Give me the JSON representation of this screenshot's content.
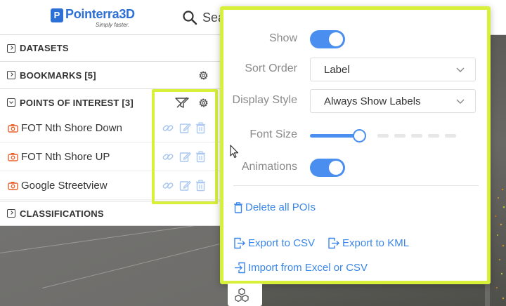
{
  "header": {
    "logo_text": "Pointerra3D",
    "logo_tagline": "Simply faster.",
    "search_text": "Sea"
  },
  "sidebar": {
    "sections": [
      {
        "label": "DATASETS",
        "expanded": false
      },
      {
        "label": "BOOKMARKS [5]",
        "expanded": false
      },
      {
        "label": "POINTS OF INTEREST [3]",
        "expanded": true
      },
      {
        "label": "CLASSIFICATIONS",
        "expanded": false
      }
    ],
    "poi_items": [
      {
        "label": "FOT Nth Shore Down"
      },
      {
        "label": "FOT Nth Shore UP"
      },
      {
        "label": "Google Streetview"
      }
    ]
  },
  "poi_settings": {
    "show_label": "Show",
    "show_enabled": true,
    "sort_order_label": "Sort Order",
    "sort_order_value": "Label",
    "display_style_label": "Display Style",
    "display_style_value": "Always Show Labels",
    "font_size_label": "Font Size",
    "font_size_level": 0.33,
    "animations_label": "Animations",
    "animations_enabled": true,
    "delete_all": "Delete all POIs",
    "export_csv": "Export to CSV",
    "export_kml": "Export to KML",
    "import_excel": "Import from Excel or CSV"
  },
  "colors": {
    "accent": "#4a8ff0",
    "link": "#3a86e8",
    "highlight": "#d8f03a",
    "poi_icon": "#e8612c",
    "action_icon": "#a9c7ef"
  },
  "icons": [
    "search-icon",
    "gear-icon",
    "filter-icon",
    "camera-icon",
    "link-icon",
    "edit-icon",
    "trash-icon",
    "chevron-down-icon",
    "export-icon",
    "import-icon",
    "cube-stack-icon"
  ]
}
